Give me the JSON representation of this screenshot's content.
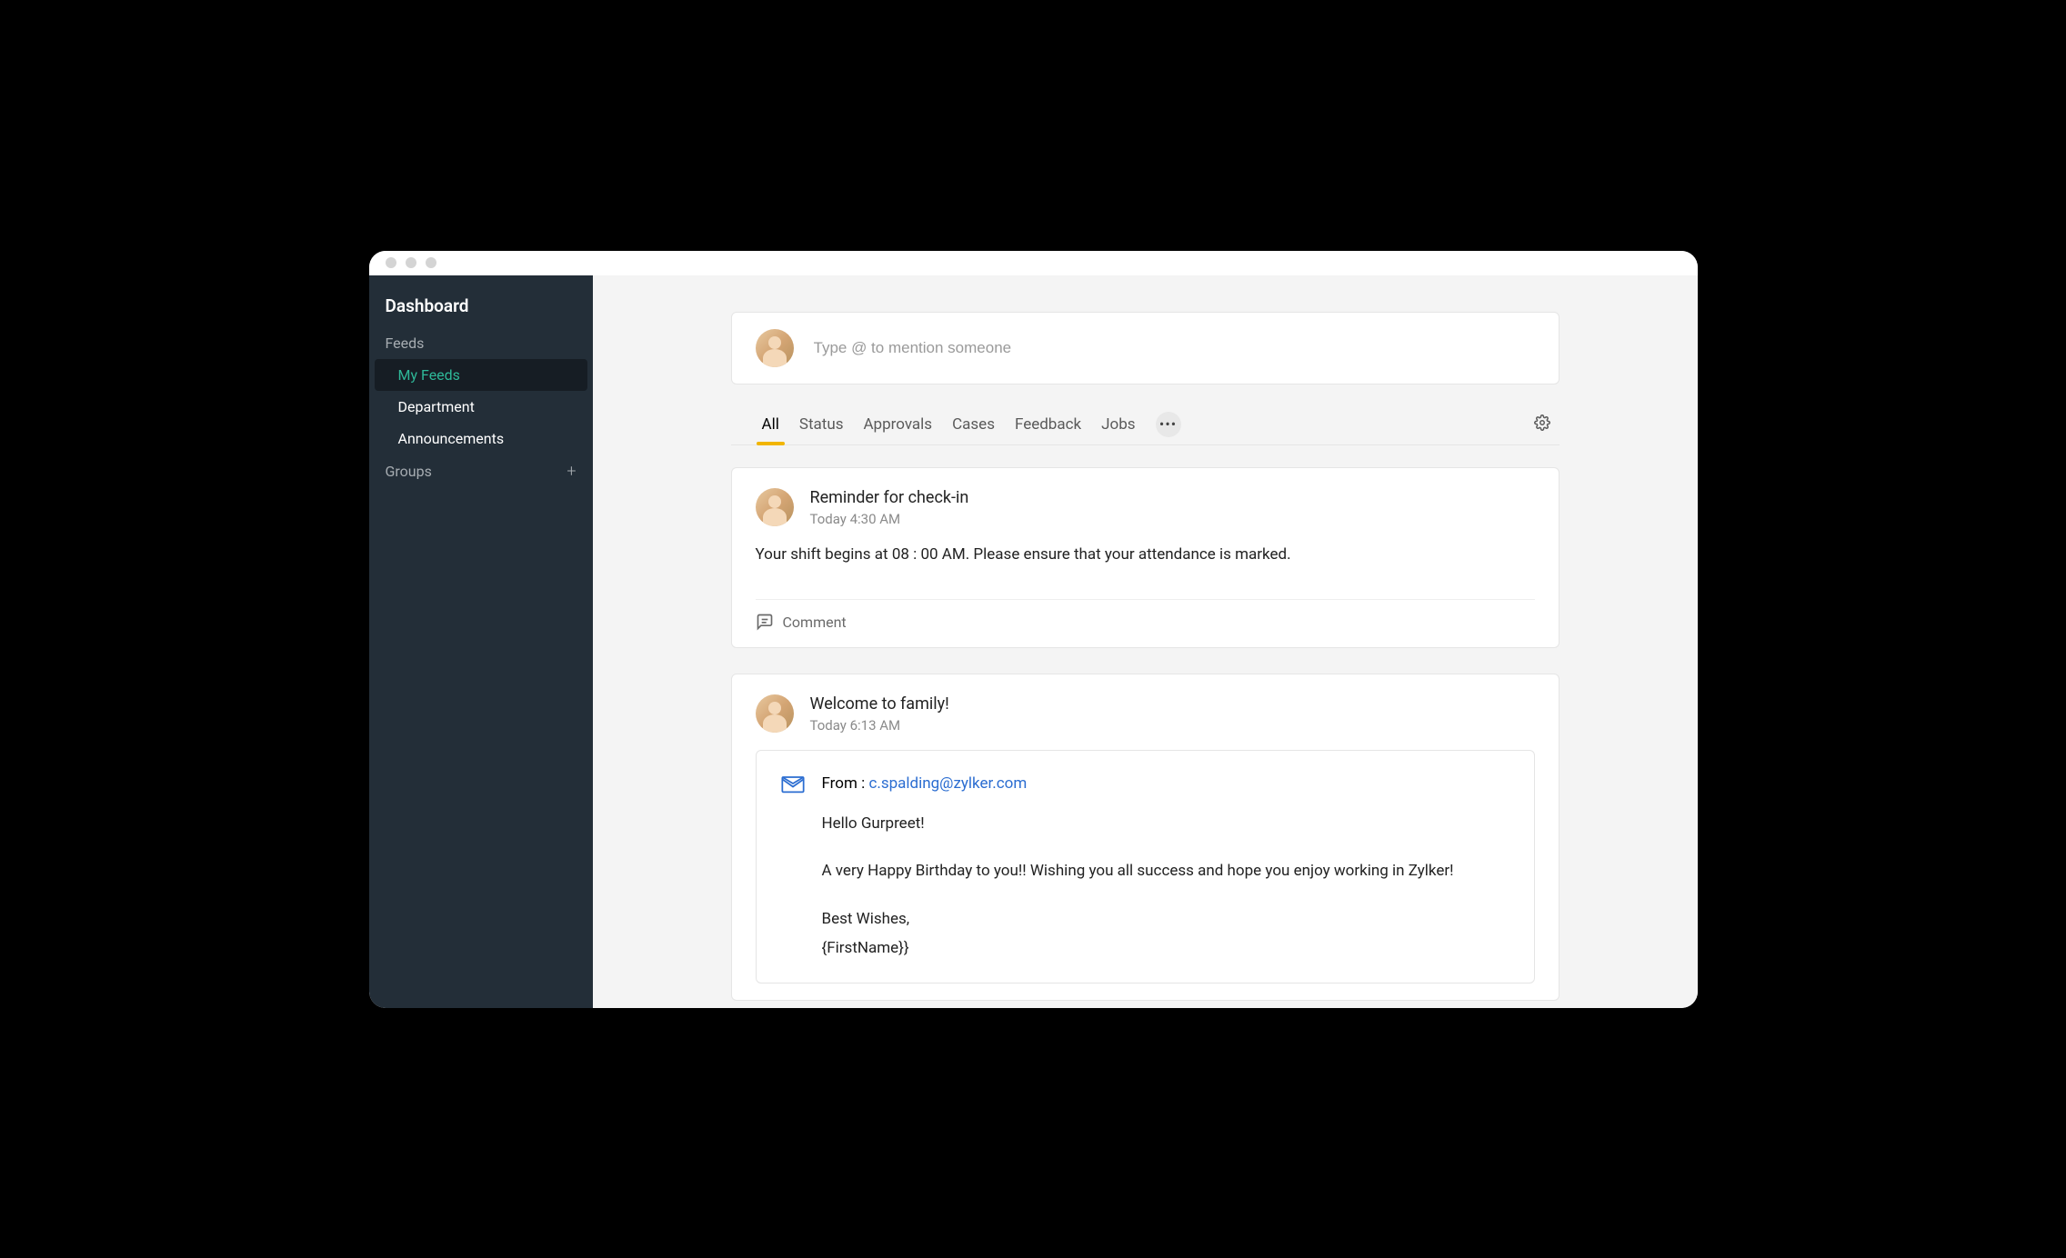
{
  "sidebar": {
    "title": "Dashboard",
    "sections": [
      {
        "label": "Feeds",
        "items": [
          {
            "label": "My Feeds",
            "active": true
          },
          {
            "label": "Department"
          },
          {
            "label": "Announcements"
          }
        ]
      },
      {
        "label": "Groups",
        "has_add": true
      }
    ]
  },
  "compose": {
    "placeholder": "Type @ to mention someone"
  },
  "tabs": [
    "All",
    "Status",
    "Approvals",
    "Cases",
    "Feedback",
    "Jobs"
  ],
  "active_tab": "All",
  "feed": [
    {
      "title": "Reminder for check-in",
      "timestamp": "Today 4:30 AM",
      "body": "Your shift begins at 08 : 00 AM. Please ensure that your attendance is marked.",
      "comment_label": "Comment"
    },
    {
      "title": "Welcome to family!",
      "timestamp": "Today 6:13 AM",
      "email": {
        "from_label": "From : ",
        "from_email": "c.spalding@zylker.com",
        "greeting": "Hello Gurpreet!",
        "message": "A very Happy Birthday to you!! Wishing you all success and hope you enjoy working in Zylker!",
        "closing_line1": "Best Wishes,",
        "closing_line2": "{FirstName}}"
      }
    }
  ]
}
